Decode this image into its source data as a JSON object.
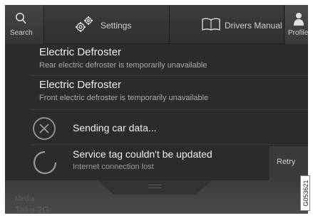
{
  "topbar": {
    "search_label": "Search",
    "settings_label": "Settings",
    "manual_label": "Drivers Manual",
    "profile_label": "Profile"
  },
  "notifications": [
    {
      "title": "Electric Defroster",
      "subtitle": "Rear electric defroster is temporarily unavailable"
    },
    {
      "title": "Electric Defroster",
      "subtitle": "Front electric defroster is temporarily unavailable"
    }
  ],
  "status": {
    "sending": {
      "title": "Sending car data..."
    },
    "service_tag": {
      "title": "Service tag couldn't be updated",
      "subtitle": "Internet connection lost",
      "action_label": "Retry"
    }
  },
  "background": {
    "line1": "Media",
    "line2": "Tako 2G"
  },
  "figure_code": "G053621"
}
